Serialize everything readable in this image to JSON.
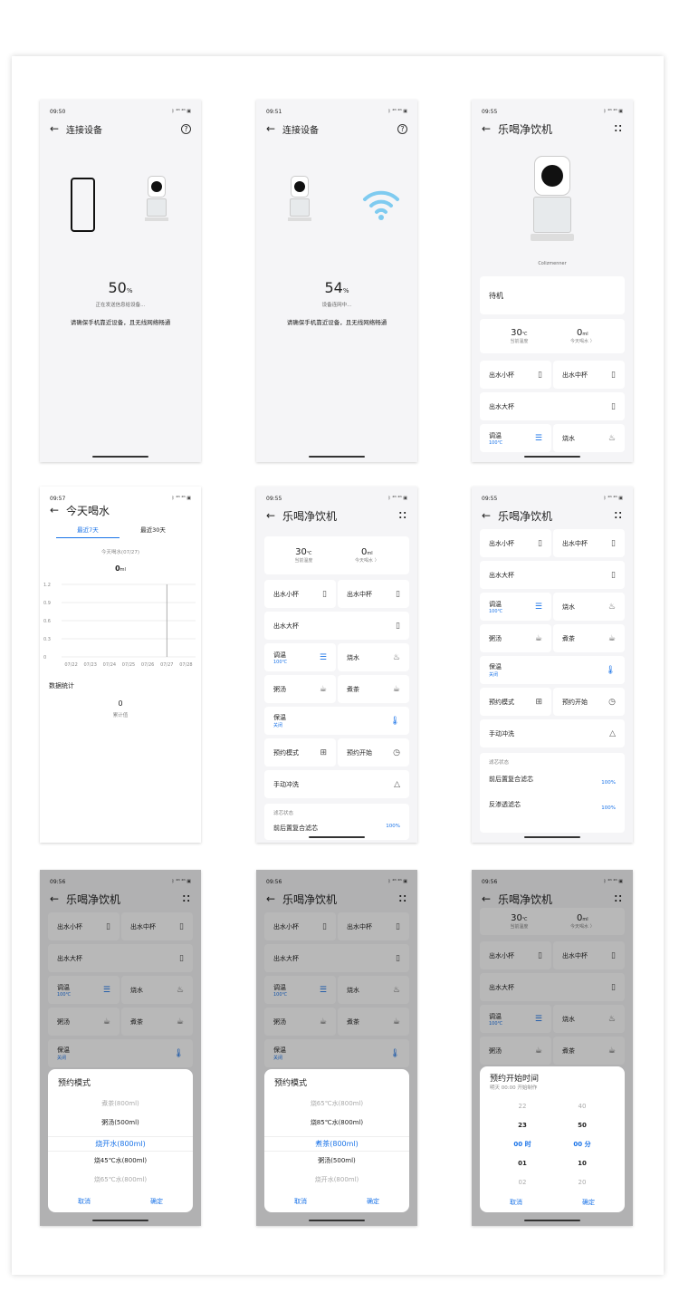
{
  "status": {
    "t1": "09:50",
    "t2": "09:51",
    "t3": "09:55",
    "t4": "09:57",
    "t5": "09:55",
    "t6": "09:55",
    "t7": "09:56",
    "t8": "09:56",
    "t9": "09:56",
    "icons": "ᛒ ⁴ᴳ ⁴ᴳ ▣"
  },
  "connect": {
    "title": "连接设备",
    "p1": "50",
    "p2": "54",
    "unit": "%",
    "msg1": "正在发送信息给设备...",
    "msg2": "设备连网中...",
    "hint": "请确保手机靠近设备，且无线网络畅通"
  },
  "device": {
    "title": "乐喝净饮机",
    "brand": "Colizmenner",
    "state": "待机",
    "temp": "30",
    "temp_unit": "℃",
    "temp_label": "当前温度",
    "drink": "0",
    "drink_unit": "ml",
    "drink_label": "今天喝水 〉"
  },
  "buttons": {
    "small": "出水小杯",
    "mid": "出水中杯",
    "large": "出水大杯",
    "adjust": "调温",
    "adjust_sub": "100℃",
    "boil": "烧水",
    "porridge": "粥汤",
    "tea": "煮茶",
    "keep": "保温",
    "keep_sub": "关闭",
    "mode": "预约模式",
    "start": "预约开始",
    "wash": "手动冲洗"
  },
  "filter": {
    "title": "滤芯状态",
    "f1": "前后置复合滤芯",
    "f2": "反渗透滤芯",
    "v1": "100%",
    "v2": "100%"
  },
  "drinkpage": {
    "title": "今天喝水",
    "tab1": "最近7天",
    "tab2": "最近30天",
    "sub": "今天喝水(07/27)",
    "val": "0",
    "unit": "ml",
    "stats": "数据统计",
    "total": "0",
    "total_label": "累计值"
  },
  "chart_data": {
    "type": "bar",
    "categories": [
      "07/22",
      "07/23",
      "07/24",
      "07/25",
      "07/26",
      "07/27",
      "07/28"
    ],
    "values": [
      0,
      0,
      0,
      0,
      0,
      0,
      0
    ],
    "yticks": [
      "1.2",
      "0.9",
      "0.6",
      "0.3",
      "0"
    ],
    "ylim": [
      0,
      1.2
    ]
  },
  "sheet1": {
    "title": "预约模式",
    "opts": [
      "煮茶(800ml)",
      "粥汤(500ml)",
      "烧开水(800ml)",
      "烧45℃水(800ml)",
      "烧65℃水(800ml)"
    ],
    "cancel": "取消",
    "ok": "确定"
  },
  "sheet2": {
    "title": "预约模式",
    "opts": [
      "烧65℃水(800ml)",
      "烧85℃水(800ml)",
      "煮茶(800ml)",
      "粥汤(500ml)",
      "烧开水(800ml)"
    ],
    "cancel": "取消",
    "ok": "确定"
  },
  "sheet3": {
    "title": "预约开始时间",
    "sub": "明天 00:00 开始制作",
    "h": [
      "22",
      "23",
      "00 时",
      "01",
      "02"
    ],
    "m": [
      "40",
      "50",
      "00 分",
      "10",
      "20"
    ],
    "cancel": "取消",
    "ok": "确定"
  }
}
